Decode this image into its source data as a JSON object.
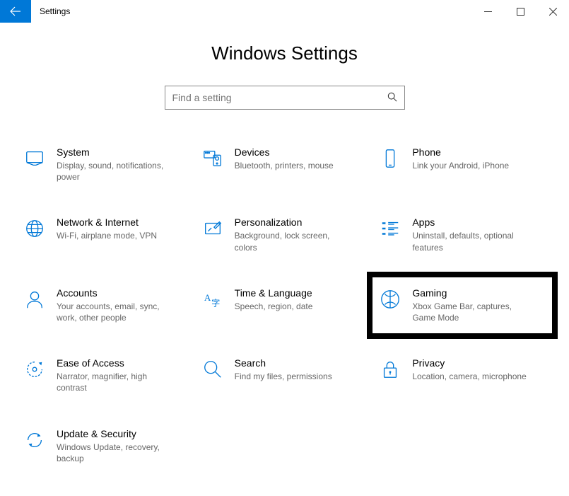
{
  "window": {
    "title": "Settings"
  },
  "page": {
    "heading": "Windows Settings"
  },
  "search": {
    "placeholder": "Find a setting"
  },
  "tiles": {
    "system": {
      "title": "System",
      "desc": "Display, sound, notifications, power"
    },
    "devices": {
      "title": "Devices",
      "desc": "Bluetooth, printers, mouse"
    },
    "phone": {
      "title": "Phone",
      "desc": "Link your Android, iPhone"
    },
    "network": {
      "title": "Network & Internet",
      "desc": "Wi-Fi, airplane mode, VPN"
    },
    "personalization": {
      "title": "Personalization",
      "desc": "Background, lock screen, colors"
    },
    "apps": {
      "title": "Apps",
      "desc": "Uninstall, defaults, optional features"
    },
    "accounts": {
      "title": "Accounts",
      "desc": "Your accounts, email, sync, work, other people"
    },
    "time": {
      "title": "Time & Language",
      "desc": "Speech, region, date"
    },
    "gaming": {
      "title": "Gaming",
      "desc": "Xbox Game Bar, captures, Game Mode"
    },
    "ease": {
      "title": "Ease of Access",
      "desc": "Narrator, magnifier, high contrast"
    },
    "search_tile": {
      "title": "Search",
      "desc": "Find my files, permissions"
    },
    "privacy": {
      "title": "Privacy",
      "desc": "Location, camera, microphone"
    },
    "update": {
      "title": "Update & Security",
      "desc": "Windows Update, recovery, backup"
    }
  }
}
